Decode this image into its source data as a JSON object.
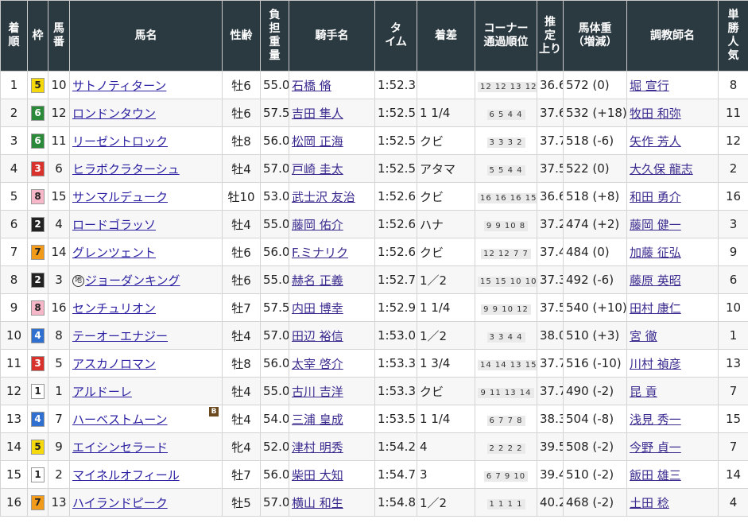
{
  "headers": {
    "rank": [
      "着",
      "順"
    ],
    "waku": [
      "枠"
    ],
    "umaban": [
      "馬",
      "番"
    ],
    "horse": [
      "馬名"
    ],
    "sexage": [
      "性齢"
    ],
    "weight": [
      "負",
      "担",
      "重",
      "量"
    ],
    "jockey": [
      "騎手名"
    ],
    "time": [
      "タ",
      "イム"
    ],
    "margin": [
      "着差"
    ],
    "corner": [
      "コーナー",
      "通過順位"
    ],
    "agari": [
      "推",
      "定",
      "上り"
    ],
    "body": [
      "馬体重",
      "（増減）"
    ],
    "trainer": [
      "調教師名"
    ],
    "pop": [
      "単",
      "勝",
      "人",
      "気"
    ]
  },
  "colors": {
    "header_bg": "#2b3941",
    "waku": {
      "1": "#ffffff",
      "2": "#222222",
      "3": "#d9312b",
      "4": "#2f6fd0",
      "5": "#f5d90a",
      "6": "#2a8a3a",
      "7": "#f29a1a",
      "8": "#f6b7c9"
    },
    "waku_text": {
      "1": "#222222",
      "2": "#ffffff",
      "3": "#ffffff",
      "4": "#ffffff",
      "5": "#222222",
      "6": "#ffffff",
      "7": "#222222",
      "8": "#222222"
    }
  },
  "rows": [
    {
      "rank": "1",
      "waku": "5",
      "umaban": "10",
      "horse": "サトノティターン",
      "mark": "",
      "blinker": false,
      "sexage": "牡6",
      "weight": "55.0",
      "jockey": "石橋 脩",
      "time": "1:52.3",
      "margin": "",
      "corner": "12 12 13 12",
      "agari": "36.6",
      "body": "572 (0)",
      "trainer": "堀 宣行",
      "pop": "8"
    },
    {
      "rank": "2",
      "waku": "6",
      "umaban": "12",
      "horse": "ロンドンタウン",
      "mark": "",
      "blinker": false,
      "sexage": "牡6",
      "weight": "57.5",
      "jockey": "吉田 隼人",
      "time": "1:52.5",
      "margin": "1 1/4",
      "corner": "6 5 4 4",
      "agari": "37.6",
      "body": "532 (+18)",
      "trainer": "牧田 和弥",
      "pop": "11"
    },
    {
      "rank": "3",
      "waku": "6",
      "umaban": "11",
      "horse": "リーゼントロック",
      "mark": "",
      "blinker": false,
      "sexage": "牡8",
      "weight": "56.0",
      "jockey": "松岡 正海",
      "time": "1:52.5",
      "margin": "クビ",
      "corner": "3 3 3 2",
      "agari": "37.7",
      "body": "518 (-6)",
      "trainer": "矢作 芳人",
      "pop": "12"
    },
    {
      "rank": "4",
      "waku": "3",
      "umaban": "6",
      "horse": "ヒラボクラターシュ",
      "mark": "",
      "blinker": false,
      "sexage": "牡4",
      "weight": "57.0",
      "jockey": "戸崎 圭太",
      "time": "1:52.5",
      "margin": "アタマ",
      "corner": "5 5 4 4",
      "agari": "37.5",
      "body": "522 (0)",
      "trainer": "大久保 龍志",
      "pop": "2"
    },
    {
      "rank": "5",
      "waku": "8",
      "umaban": "15",
      "horse": "サンマルデューク",
      "mark": "",
      "blinker": false,
      "sexage": "牡10",
      "weight": "53.0",
      "jockey": "武士沢 友治",
      "time": "1:52.6",
      "margin": "クビ",
      "corner": "16 16 16 15",
      "agari": "36.6",
      "body": "518 (+8)",
      "trainer": "和田 勇介",
      "pop": "16"
    },
    {
      "rank": "6",
      "waku": "2",
      "umaban": "4",
      "horse": "ロードゴラッソ",
      "mark": "",
      "blinker": false,
      "sexage": "牡4",
      "weight": "55.0",
      "jockey": "藤岡 佑介",
      "time": "1:52.6",
      "margin": "ハナ",
      "corner": "9 9 10 8",
      "agari": "37.2",
      "body": "474 (+2)",
      "trainer": "藤岡 健一",
      "pop": "3"
    },
    {
      "rank": "7",
      "waku": "7",
      "umaban": "14",
      "horse": "グレンツェント",
      "mark": "",
      "blinker": false,
      "sexage": "牡6",
      "weight": "56.0",
      "jockey": "F.ミナリク",
      "time": "1:52.6",
      "margin": "クビ",
      "corner": "12 12 7 7",
      "agari": "37.4",
      "body": "484 (0)",
      "trainer": "加藤 征弘",
      "pop": "9"
    },
    {
      "rank": "8",
      "waku": "2",
      "umaban": "3",
      "horse": "ジョーダンキング",
      "mark": "地",
      "blinker": false,
      "sexage": "牡6",
      "weight": "55.0",
      "jockey": "赫名 正義",
      "time": "1:52.7",
      "margin": "1／2",
      "corner": "15 15 10 10",
      "agari": "37.3",
      "body": "492 (-6)",
      "trainer": "藤原 英昭",
      "pop": "6"
    },
    {
      "rank": "9",
      "waku": "8",
      "umaban": "16",
      "horse": "センチュリオン",
      "mark": "",
      "blinker": false,
      "sexage": "牡7",
      "weight": "57.5",
      "jockey": "内田 博幸",
      "time": "1:52.9",
      "margin": "1 1/4",
      "corner": "9 9 10 12",
      "agari": "37.5",
      "body": "540 (+10)",
      "trainer": "田村 康仁",
      "pop": "10"
    },
    {
      "rank": "10",
      "waku": "4",
      "umaban": "8",
      "horse": "テーオーエナジー",
      "mark": "",
      "blinker": false,
      "sexage": "牡4",
      "weight": "57.0",
      "jockey": "田辺 裕信",
      "time": "1:53.0",
      "margin": "1／2",
      "corner": "3 3 4 4",
      "agari": "38.0",
      "body": "510 (+3)",
      "trainer": "宮 徹",
      "pop": "1"
    },
    {
      "rank": "11",
      "waku": "3",
      "umaban": "5",
      "horse": "アスカノロマン",
      "mark": "",
      "blinker": false,
      "sexage": "牡8",
      "weight": "56.0",
      "jockey": "太宰 啓介",
      "time": "1:53.3",
      "margin": "1 3/4",
      "corner": "14 14 13 15",
      "agari": "37.7",
      "body": "516 (-10)",
      "trainer": "川村 禎彦",
      "pop": "13"
    },
    {
      "rank": "12",
      "waku": "1",
      "umaban": "1",
      "horse": "アルドーレ",
      "mark": "",
      "blinker": false,
      "sexage": "牡4",
      "weight": "55.0",
      "jockey": "古川 吉洋",
      "time": "1:53.3",
      "margin": "クビ",
      "corner": "9 11 13 14",
      "agari": "37.7",
      "body": "490 (-2)",
      "trainer": "昆 貢",
      "pop": "7"
    },
    {
      "rank": "13",
      "waku": "4",
      "umaban": "7",
      "horse": "ハーベストムーン",
      "mark": "",
      "blinker": true,
      "sexage": "牡4",
      "weight": "54.0",
      "jockey": "三浦 皇成",
      "time": "1:53.5",
      "margin": "1 1/4",
      "corner": "6 7 7 8",
      "agari": "38.3",
      "body": "504 (-8)",
      "trainer": "浅見 秀一",
      "pop": "15"
    },
    {
      "rank": "14",
      "waku": "5",
      "umaban": "9",
      "horse": "エイシンセラード",
      "mark": "",
      "blinker": false,
      "sexage": "牝4",
      "weight": "52.0",
      "jockey": "津村 明秀",
      "time": "1:54.2",
      "margin": "4",
      "corner": "2 2 2 2",
      "agari": "39.5",
      "body": "508 (-2)",
      "trainer": "今野 貞一",
      "pop": "7"
    },
    {
      "rank": "15",
      "waku": "1",
      "umaban": "2",
      "horse": "マイネルオフィール",
      "mark": "",
      "blinker": false,
      "sexage": "牡7",
      "weight": "56.0",
      "jockey": "柴田 大知",
      "time": "1:54.7",
      "margin": "3",
      "corner": "6 7 9 10",
      "agari": "39.4",
      "body": "510 (-2)",
      "trainer": "飯田 雄三",
      "pop": "14"
    },
    {
      "rank": "16",
      "waku": "7",
      "umaban": "13",
      "horse": "ハイランドピーク",
      "mark": "",
      "blinker": false,
      "sexage": "牡5",
      "weight": "57.0",
      "jockey": "横山 和生",
      "time": "1:54.8",
      "margin": "1／2",
      "corner": "1 1 1 1",
      "agari": "40.2",
      "body": "468 (-2)",
      "trainer": "土田 稔",
      "pop": "4"
    }
  ]
}
